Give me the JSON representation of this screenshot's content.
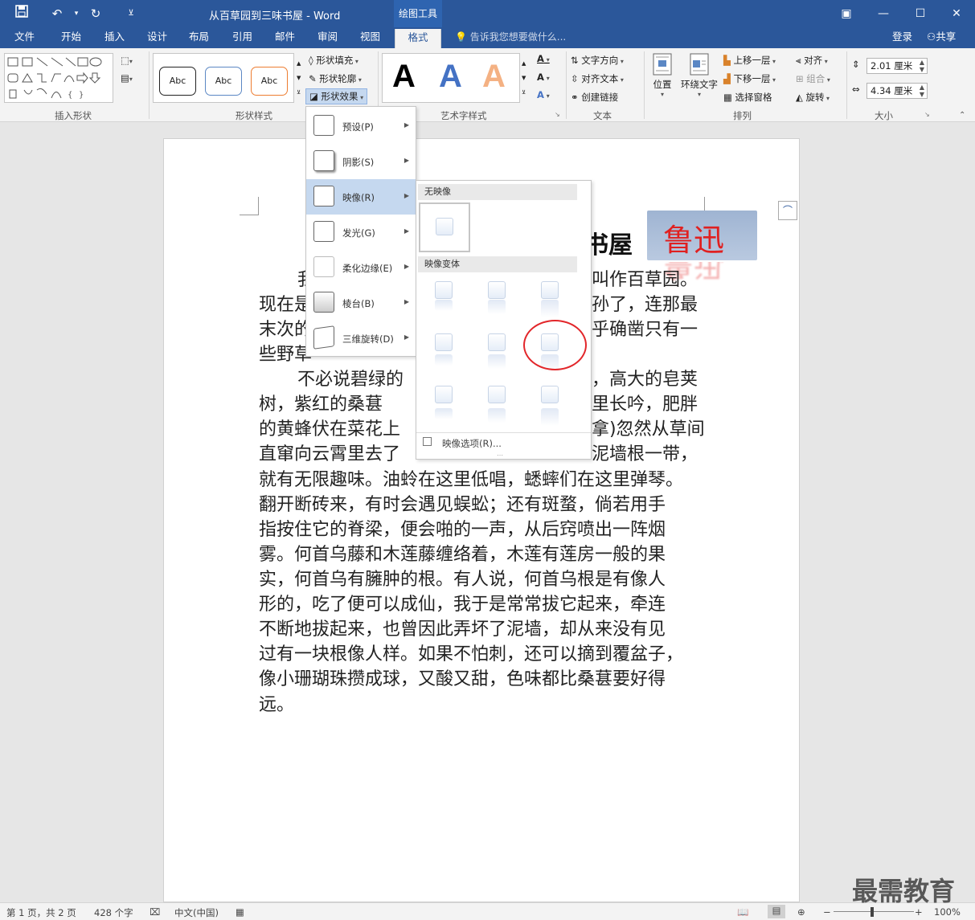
{
  "titlebar": {
    "doc_title": "从百草园到三味书屋 - Word",
    "context_tools": "绘图工具"
  },
  "tabs": [
    "文件",
    "开始",
    "插入",
    "设计",
    "布局",
    "引用",
    "邮件",
    "审阅",
    "视图",
    "格式"
  ],
  "tell_me": "告诉我您想要做什么...",
  "account": {
    "login": "登录",
    "share": "共享"
  },
  "ribbon": {
    "groups": {
      "insert_shapes": "插入形状",
      "shape_styles": "形状样式",
      "wordart_styles": "艺术字样式",
      "text": "文本",
      "arrange": "排列",
      "size": "大小"
    },
    "style_samples": [
      "Abc",
      "Abc",
      "Abc"
    ],
    "shape_fill": "形状填充",
    "shape_outline": "形状轮廓",
    "shape_effects": "形状效果",
    "wordart_letter": "A",
    "text_direction": "文字方向",
    "align_text": "对齐文本",
    "create_link": "创建链接",
    "position": "位置",
    "wrap_text": "环绕文字",
    "bring_forward": "上移一层",
    "send_backward": "下移一层",
    "selection_pane": "选择窗格",
    "align": "对齐",
    "group": "组合",
    "rotate": "旋转",
    "height": "2.01 厘米",
    "width": "4.34 厘米"
  },
  "effects_menu": [
    {
      "label": "预设(P)",
      "highlighted": false
    },
    {
      "label": "阴影(S)",
      "highlighted": false
    },
    {
      "label": "映像(R)",
      "highlighted": true
    },
    {
      "label": "发光(G)",
      "highlighted": false
    },
    {
      "label": "柔化边缘(E)",
      "highlighted": false
    },
    {
      "label": "棱台(B)",
      "highlighted": false
    },
    {
      "label": "三维旋转(D)",
      "highlighted": false
    }
  ],
  "reflection_submenu": {
    "no_reflection": "无映像",
    "variations": "映像变体",
    "options": "映像选项(R)..."
  },
  "document": {
    "title_visible": "书屋",
    "wordart_text": "鲁迅",
    "lines": [
      "我",
      "现在是",
      "末次的",
      "些野草",
      "不必说碧绿的",
      "树，紫红的桑葚",
      "的黄蜂伏在菜花上",
      "直窜向云霄里去了",
      "就有无限趣味。油蛉在这里低唱，蟋蟀们在这里弹琴。",
      "翻开断砖来，有时会遇见蜈蚣；还有斑蝥，倘若用手",
      "指按住它的脊梁，便会啪的一声，从后窍喷出一阵烟",
      "雾。何首乌藤和木莲藤缠络着，木莲有莲房一般的果",
      "实，何首乌有臃肿的根。有人说，何首乌根是有像人",
      "形的，吃了便可以成仙，我于是常常拔它起来，牵连",
      "不断地拔起来，也曾因此弄坏了泥墙，却从来没有见",
      "过有一块根像人样。如果不怕刺，还可以摘到覆盆子，",
      "像小珊瑚珠攒成球，又酸又甜，色味都比桑葚要好得",
      "远。"
    ],
    "right_fragments": [
      "叫作百草园。",
      "孙了，连那最",
      "乎确凿只有一",
      "，高大的皂荚",
      "里长吟，肥胖",
      "拿)忽然从草间",
      "泥墙根一带，"
    ]
  },
  "status": {
    "page": "第 1 页，共 2 页",
    "words": "428 个字",
    "language": "中文(中国)",
    "zoom": "100%"
  },
  "watermark": "最需教育"
}
